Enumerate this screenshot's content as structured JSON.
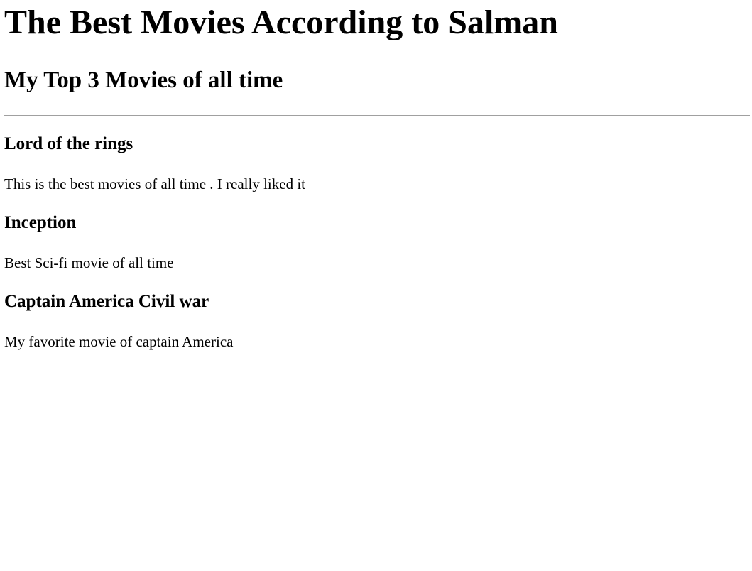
{
  "page": {
    "title": "The Best Movies According to Salman",
    "subtitle": "My Top 3 Movies of all time"
  },
  "movies": [
    {
      "title": "Lord of the rings",
      "description": "This is the best movies of all time . I really liked it"
    },
    {
      "title": "Inception",
      "description": "Best Sci-fi movie of all time"
    },
    {
      "title": "Captain America Civil war",
      "description": "My favorite movie of captain America"
    }
  ]
}
